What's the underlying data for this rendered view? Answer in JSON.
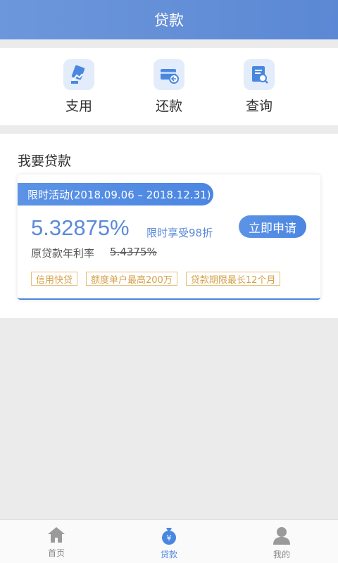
{
  "header": {
    "title": "贷款"
  },
  "quick_actions": [
    {
      "label": "支用",
      "icon": "hand-card-icon"
    },
    {
      "label": "还款",
      "icon": "card-return-icon"
    },
    {
      "label": "查询",
      "icon": "document-search-icon"
    }
  ],
  "loan_section": {
    "title": "我要贷款",
    "card": {
      "promo": "限时活动(2018.09.06 – 2018.12.31)",
      "rate": "5.32875%",
      "discount": "限时享受98折",
      "apply_label": "立即申请",
      "orig_label": "原贷款年利率",
      "orig_rate": "5.4375%",
      "tags": [
        "信用快贷",
        "额度单户最高200万",
        "贷款期限最长12个月"
      ]
    }
  },
  "bottom_nav": [
    {
      "label": "首页",
      "icon": "home-icon",
      "active": false
    },
    {
      "label": "贷款",
      "icon": "money-bag-icon",
      "active": true
    },
    {
      "label": "我的",
      "icon": "user-icon",
      "active": false
    }
  ],
  "colors": {
    "primary": "#4a87e0",
    "tag": "#d4a14c",
    "background": "#ebebeb"
  }
}
